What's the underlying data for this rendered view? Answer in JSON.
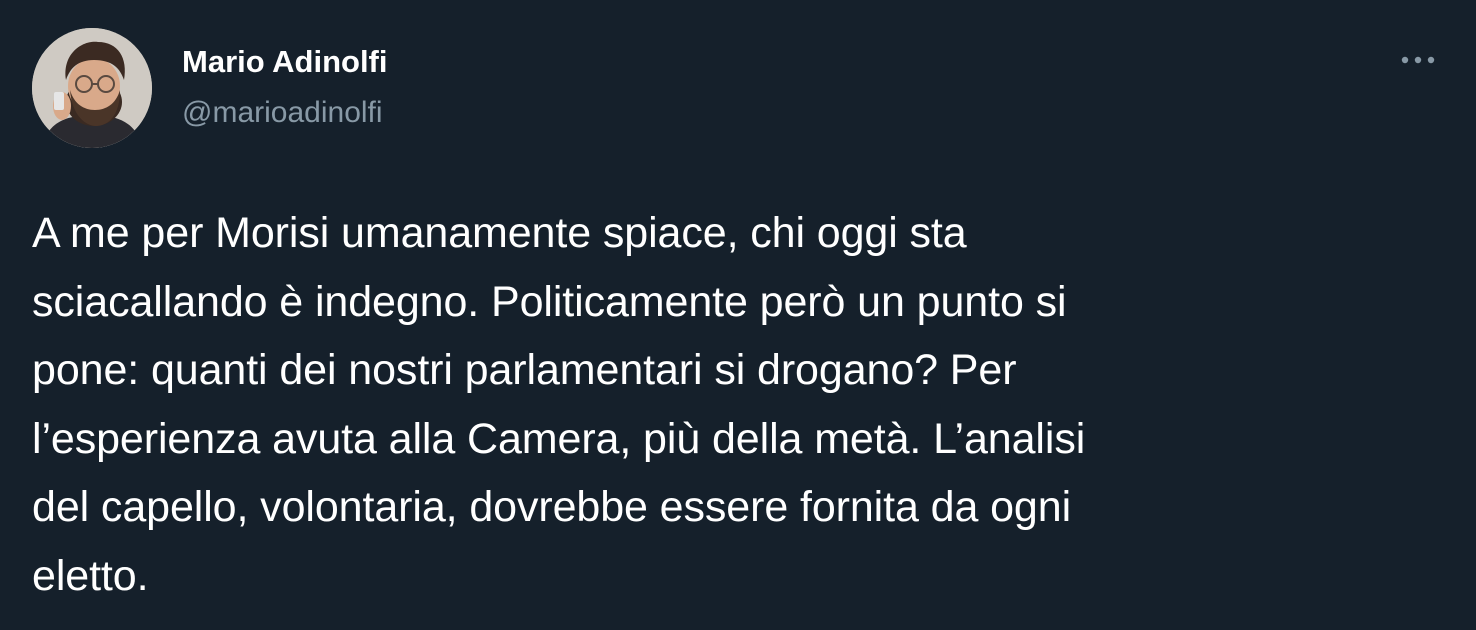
{
  "tweet": {
    "author": {
      "name": "Mario Adinolfi",
      "handle": "@marioadinolfi",
      "avatar_icon": "user-avatar"
    },
    "more_icon": "more-horizontal-icon",
    "text": "A me per Morisi umanamente spiace, chi oggi sta\nsciacallando è indegno. Politicamente però un punto si\npone: quanti dei nostri parlamentari si drogano? Per\nl’esperienza avuta alla Camera, più della metà. L’analisi\ndel capello, volontaria, dovrebbe essere fornita da ogni\neletto."
  },
  "colors": {
    "background": "#15202b",
    "text_primary": "#ffffff",
    "text_secondary": "#8899a6"
  }
}
